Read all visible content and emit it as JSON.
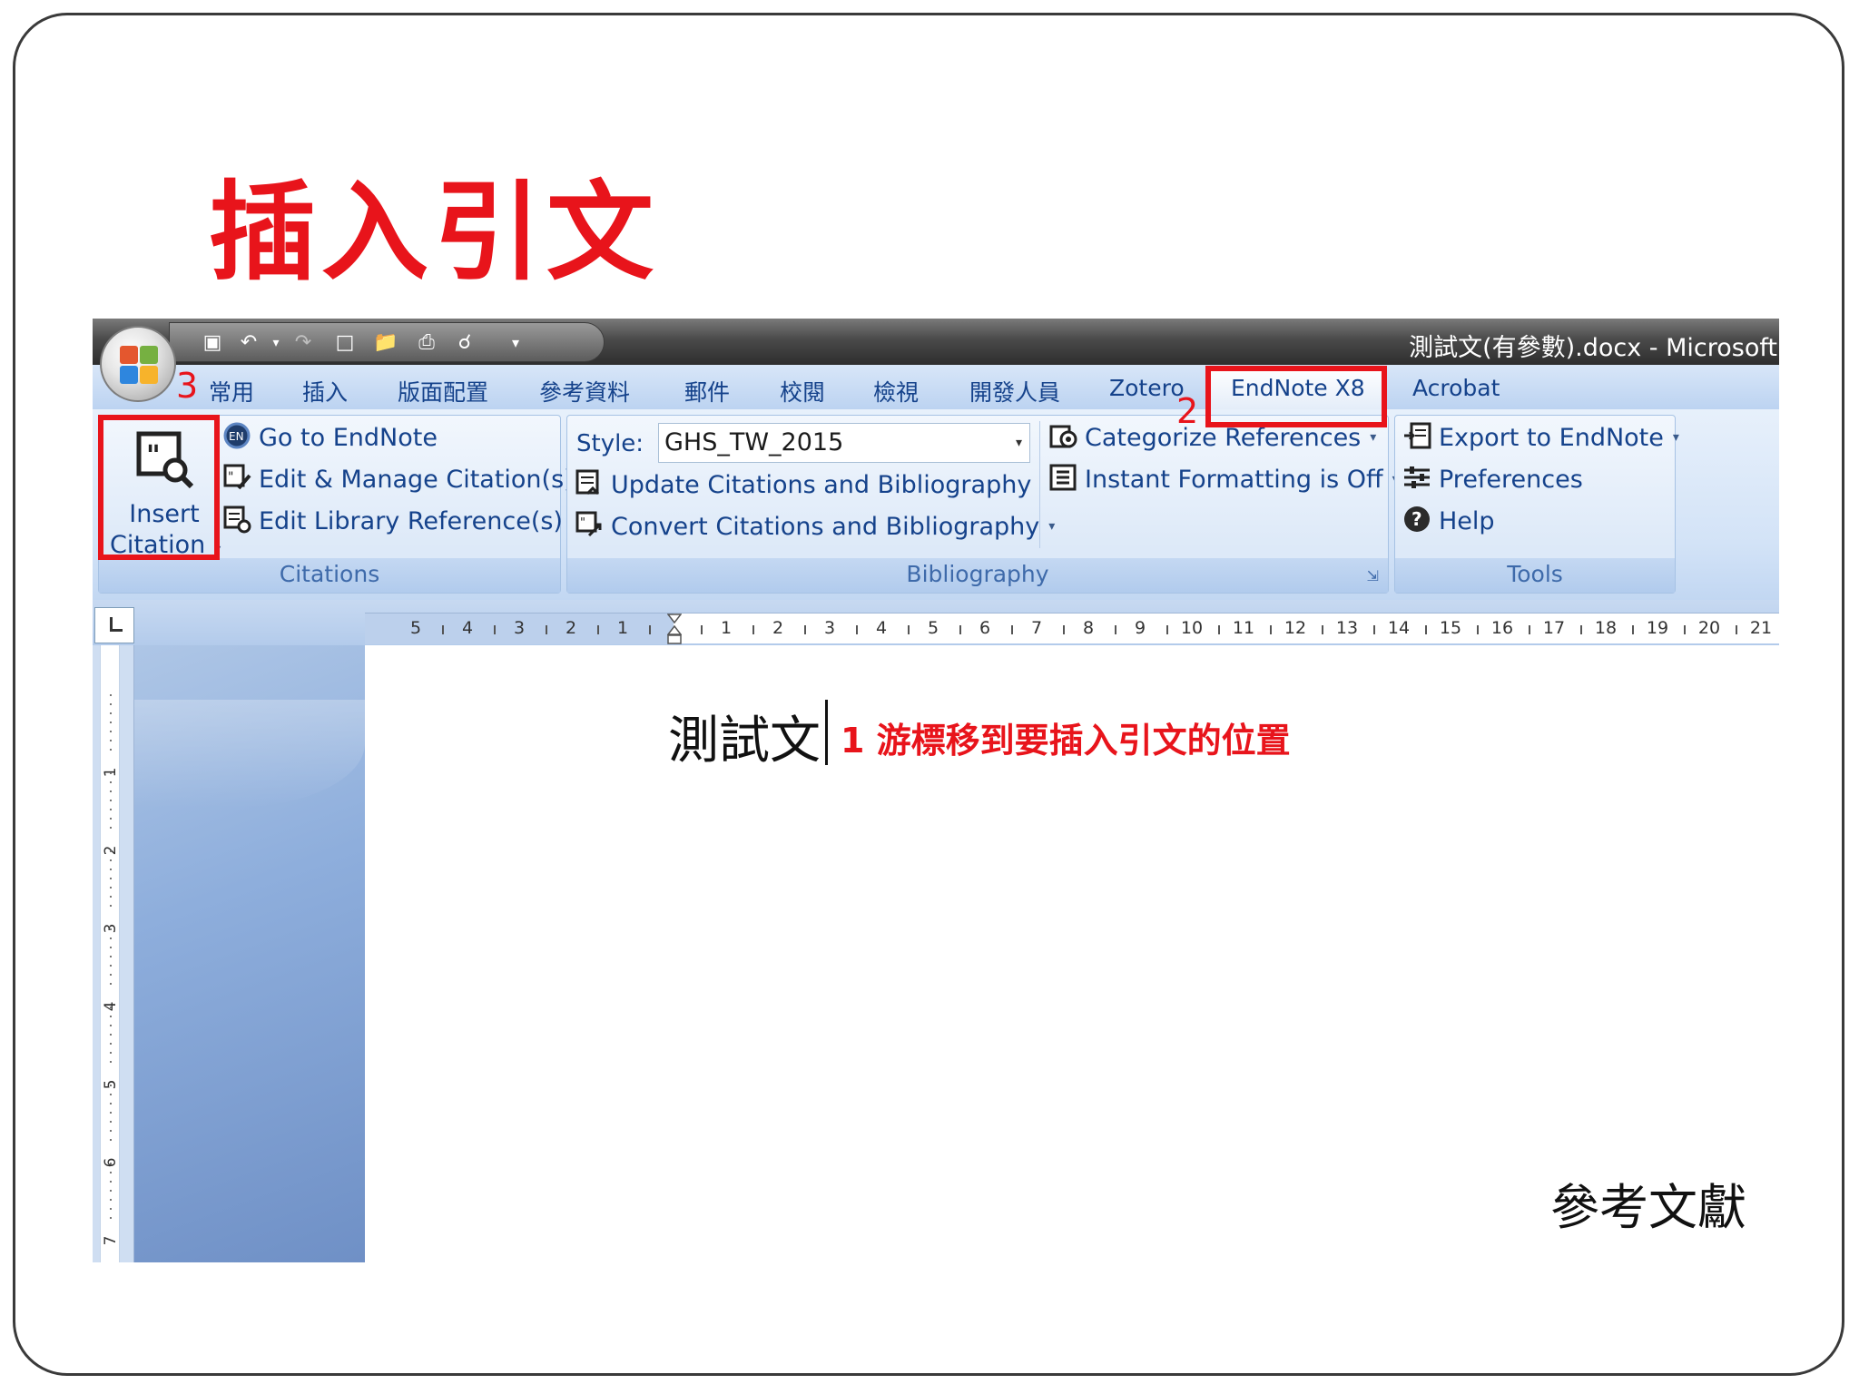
{
  "slide": {
    "title": "插入引文"
  },
  "window": {
    "title": "測試文(有參數).docx - Microsoft"
  },
  "tabs": [
    {
      "label": "常用"
    },
    {
      "label": "插入"
    },
    {
      "label": "版面配置"
    },
    {
      "label": "參考資料"
    },
    {
      "label": "郵件"
    },
    {
      "label": "校閱"
    },
    {
      "label": "檢視"
    },
    {
      "label": "開發人員"
    },
    {
      "label": "Zotero"
    },
    {
      "label": "EndNote X8",
      "active": true
    },
    {
      "label": "Acrobat"
    }
  ],
  "ribbon": {
    "citations": {
      "group_label": "Citations",
      "insert_citation_line1": "Insert",
      "insert_citation_line2": "Citation",
      "items": [
        {
          "label": "Go to EndNote",
          "icon": "endnote-icon"
        },
        {
          "label": "Edit & Manage Citation(s)",
          "icon": "edit-citation-icon"
        },
        {
          "label": "Edit Library Reference(s)",
          "icon": "edit-library-icon"
        }
      ]
    },
    "bibliography": {
      "group_label": "Bibliography",
      "style_label": "Style:",
      "style_value": "GHS_TW_2015",
      "items": [
        {
          "label": "Update Citations and Bibliography",
          "icon": "update-icon"
        },
        {
          "label": "Convert Citations and Bibliography",
          "icon": "convert-icon"
        },
        {
          "label": "Categorize References",
          "icon": "categorize-icon"
        },
        {
          "label": "Instant Formatting is Off",
          "icon": "instant-format-icon"
        }
      ]
    },
    "tools": {
      "group_label": "Tools",
      "items": [
        {
          "label": "Export to EndNote",
          "icon": "export-icon"
        },
        {
          "label": "Preferences",
          "icon": "preferences-icon"
        },
        {
          "label": "Help",
          "icon": "help-icon"
        }
      ]
    }
  },
  "annotations": {
    "step1": "1 游標移到要插入引文的位置",
    "step2": "2",
    "step3": "3"
  },
  "ruler": {
    "left_numbers": [
      "5",
      "4",
      "3",
      "2",
      "1"
    ],
    "right_numbers": [
      "1",
      "2",
      "3",
      "4",
      "5",
      "6",
      "7",
      "8",
      "9",
      "10",
      "11",
      "12",
      "13",
      "14",
      "15",
      "16",
      "17",
      "18",
      "19",
      "20",
      "21"
    ],
    "vertical_numbers": [
      "1",
      "2",
      "3",
      "4",
      "5",
      "6",
      "7"
    ]
  },
  "document": {
    "body_text": "測試文",
    "reference_heading": "參考文獻"
  },
  "colors": {
    "annotation_red": "#e8141b",
    "ribbon_text": "#15428b"
  }
}
